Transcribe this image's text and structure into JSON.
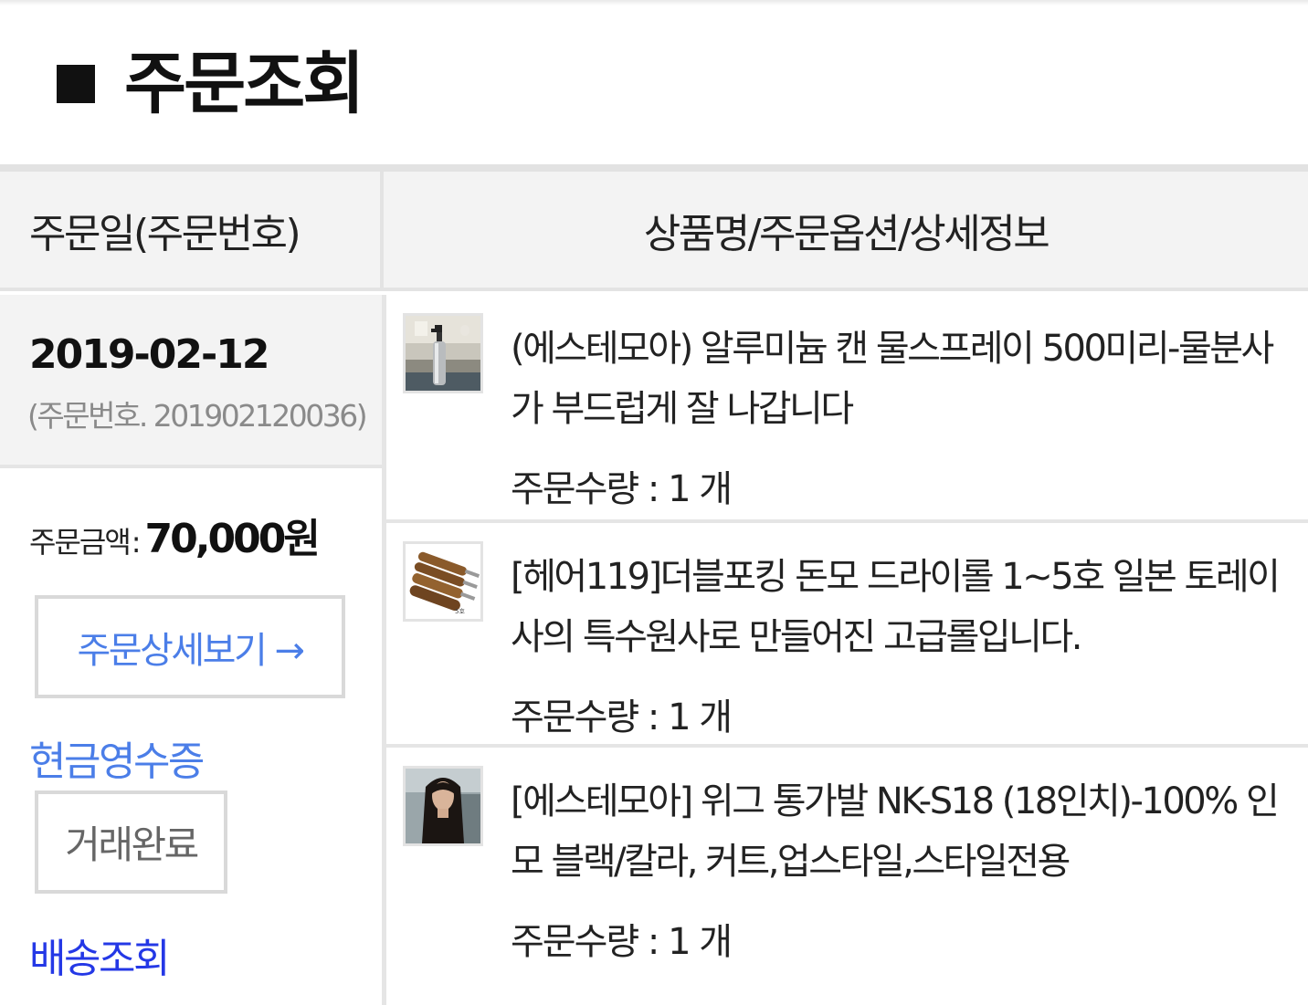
{
  "page": {
    "title": "주문조회"
  },
  "table": {
    "headers": {
      "order_date": "주문일(주문번호)",
      "product_info": "상품명/주문옵션/상세정보"
    }
  },
  "order": {
    "date": "2019-02-12",
    "number_text": "(주문번호. 201902120036)",
    "amount_label": "주문금액",
    "amount_value": "70,000원",
    "detail_button": "주문상세보기 →",
    "cash_receipt": "현금영수증",
    "status": "거래완료",
    "delivery": "배송조회"
  },
  "items": [
    {
      "name": "(에스테모아) 알루미늄 캔 물스프레이 500미리-물분사가 부드럽게 잘 나갑니다",
      "quantity": "주문수량 : 1 개",
      "icon": "spray-bottle-thumbnail"
    },
    {
      "name": "[헤어119]더블포킹 돈모 드라이롤 1~5호 일본 토레이사의 특수원사로 만들어진 고급롤입니다.",
      "quantity": "주문수량 : 1 개",
      "icon": "brush-thumbnail"
    },
    {
      "name": "[에스테모아] 위그 통가발 NK-S18 (18인치)-100% 인모 블랙/칼라, 커트,업스타일,스타일전용",
      "quantity": "주문수량 : 1 개",
      "icon": "wig-thumbnail"
    }
  ],
  "colors": {
    "link_blue": "#4b7ee8",
    "delivery_blue": "#2438e6",
    "header_bg": "#f3f3f3",
    "border": "#e3e3e3"
  }
}
